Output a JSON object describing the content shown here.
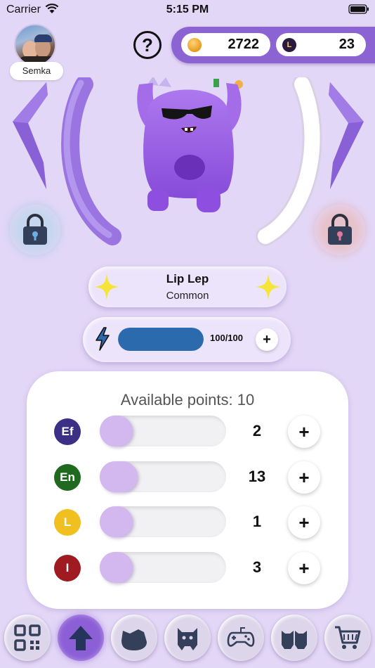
{
  "status_bar": {
    "carrier": "Carrier",
    "time": "5:15 PM"
  },
  "profile": {
    "username": "Semka"
  },
  "help": {
    "label": "?"
  },
  "currency": {
    "coins": {
      "icon": "coin-icon",
      "value": "2722"
    },
    "lepi": {
      "icon": "lepi-token-icon",
      "value": "23"
    }
  },
  "monster": {
    "name": "Lip Lep",
    "rarity": "Common",
    "body_color": "#9b5ee8"
  },
  "energy": {
    "label": "100/100",
    "level": 1.0,
    "fill_color": "#2c6aae"
  },
  "stats": {
    "title": "Available points: 10",
    "rows": [
      {
        "icon_label": "Ef",
        "icon_color": "#3b2f86",
        "value": "2",
        "level": 0.15
      },
      {
        "icon_label": "En",
        "icon_color": "#1f6a1e",
        "value": "13",
        "level": 0.3
      },
      {
        "icon_label": "L",
        "icon_color": "#f0c020",
        "value": "1",
        "level": 0.15
      },
      {
        "icon_label": "I",
        "icon_color": "#a01a22",
        "value": "3",
        "level": 0.15
      }
    ],
    "add_label": "+"
  },
  "energy_add_label": "+",
  "nav": [
    {
      "icon": "qr-code-icon"
    },
    {
      "icon": "upgrade-arrow-icon",
      "active": true
    },
    {
      "icon": "monster-head-icon"
    },
    {
      "icon": "monster-icon"
    },
    {
      "icon": "gamepad-icon"
    },
    {
      "icon": "monsters-group-icon"
    },
    {
      "icon": "shopping-cart-icon"
    }
  ],
  "colors": {
    "background": "#e3d7f7",
    "accent": "#8c63d3",
    "card": "#ffffff"
  }
}
